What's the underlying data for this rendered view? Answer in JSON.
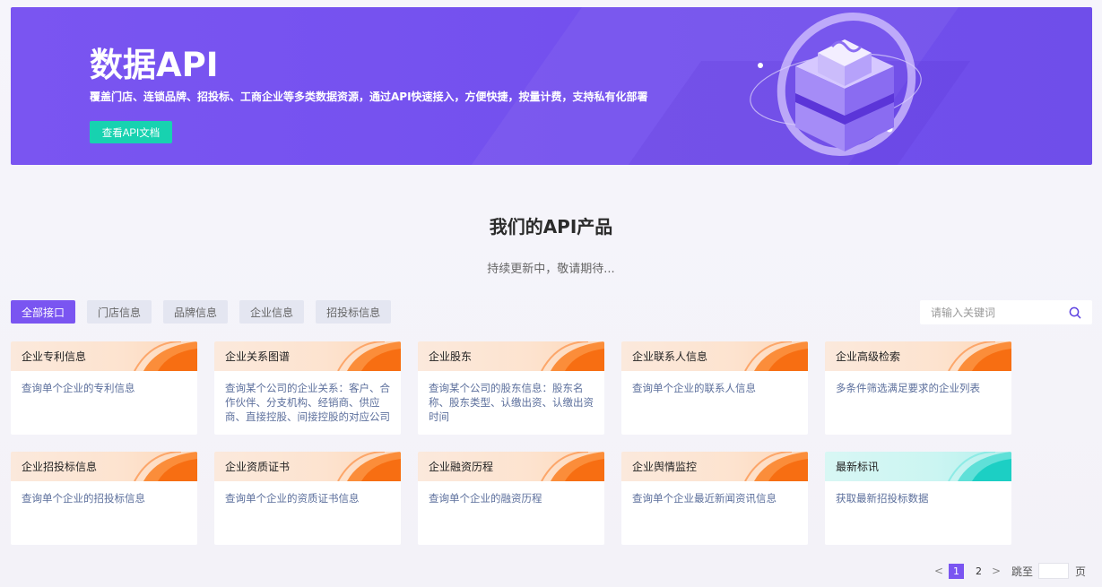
{
  "banner": {
    "title": "数据API",
    "subtitle": "覆盖门店、连锁品牌、招投标、工商企业等多类数据资源，通过API快速接入，方便快捷，按量计费，支持私有化部署",
    "cta_label": "查看API文档",
    "colors": {
      "background": "#7a55f1",
      "cta": "#17d2b0"
    }
  },
  "section": {
    "title": "我们的API产品",
    "subtitle": "持续更新中，敬请期待..."
  },
  "tabs": [
    {
      "label": "全部接口",
      "active": true
    },
    {
      "label": "门店信息",
      "active": false
    },
    {
      "label": "品牌信息",
      "active": false
    },
    {
      "label": "企业信息",
      "active": false
    },
    {
      "label": "招投标信息",
      "active": false
    }
  ],
  "search": {
    "placeholder": "请输入关键词",
    "icon": "search-icon"
  },
  "cards": [
    {
      "name": "企业专利信息",
      "desc": "查询单个企业的专利信息",
      "theme": "orange"
    },
    {
      "name": "企业关系图谱",
      "desc": "查询某个公司的企业关系：客户、合作伙伴、分支机构、经销商、供应商、直接控股、间接控股的对应公司",
      "theme": "orange"
    },
    {
      "name": "企业股东",
      "desc": "查询某个公司的股东信息：股东名称、股东类型、认缴出资、认缴出资时间",
      "theme": "orange"
    },
    {
      "name": "企业联系人信息",
      "desc": "查询单个企业的联系人信息",
      "theme": "orange"
    },
    {
      "name": "企业高级检索",
      "desc": "多条件筛选满足要求的企业列表",
      "theme": "orange"
    },
    {
      "name": "企业招投标信息",
      "desc": "查询单个企业的招投标信息",
      "theme": "orange"
    },
    {
      "name": "企业资质证书",
      "desc": "查询单个企业的资质证书信息",
      "theme": "orange"
    },
    {
      "name": "企业融资历程",
      "desc": "查询单个企业的融资历程",
      "theme": "orange"
    },
    {
      "name": "企业舆情监控",
      "desc": "查询单个企业最近新闻资讯信息",
      "theme": "orange"
    },
    {
      "name": "最新标讯",
      "desc": "获取最新招投标数据",
      "theme": "teal"
    }
  ],
  "pagination": {
    "prev": "<",
    "next": ">",
    "pages": [
      "1",
      "2"
    ],
    "current": "1",
    "jump_label": "跳至",
    "jump_unit": "页"
  },
  "accent_color": "#7a55f1"
}
